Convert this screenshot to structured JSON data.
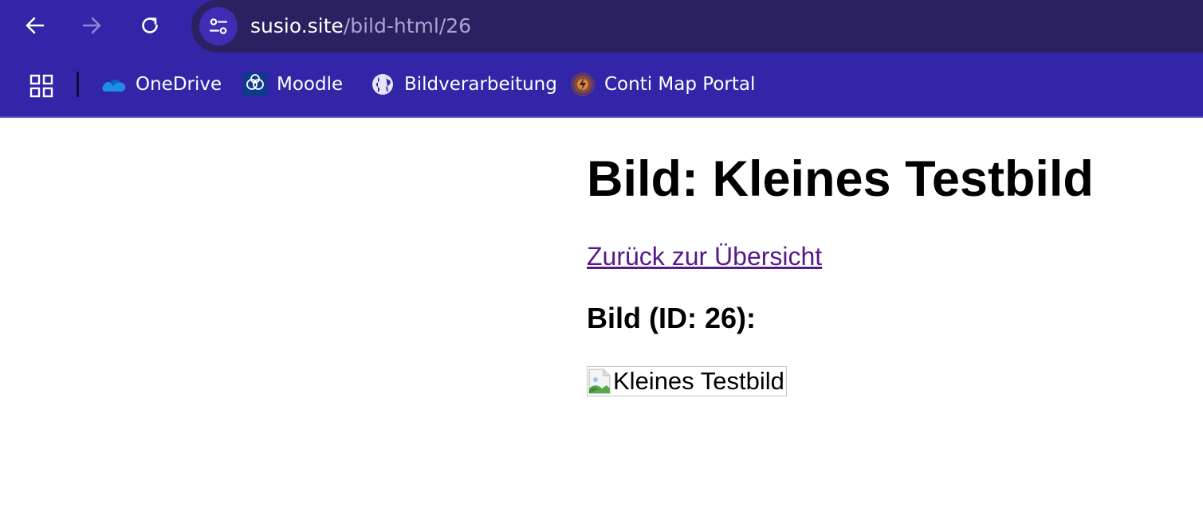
{
  "browser": {
    "url_host": "susio.site",
    "url_path": "/bild-html/26",
    "nav": {
      "back_icon": "arrow-left-icon",
      "forward_icon": "arrow-right-icon",
      "reload_icon": "reload-icon",
      "site_info_icon": "tune-icon"
    },
    "bookmarks": [
      {
        "label": "OneDrive",
        "icon": "onedrive-cloud-icon"
      },
      {
        "label": "Moodle",
        "icon": "moodle-icon"
      },
      {
        "label": "Bildverarbeitung",
        "icon": "globe-icon"
      },
      {
        "label": "Conti Map Portal",
        "icon": "conti-map-icon"
      }
    ],
    "apps_icon": "apps-grid-icon",
    "accent": "#3325a8",
    "omnibox_bg": "#2b2161"
  },
  "page": {
    "title": "Bild: Kleines Testbild",
    "back_link": "Zurück zur Übersicht",
    "image_heading": "Bild (ID: 26):",
    "image_alt": "Kleines Testbild",
    "link_color": "#551a8b"
  }
}
